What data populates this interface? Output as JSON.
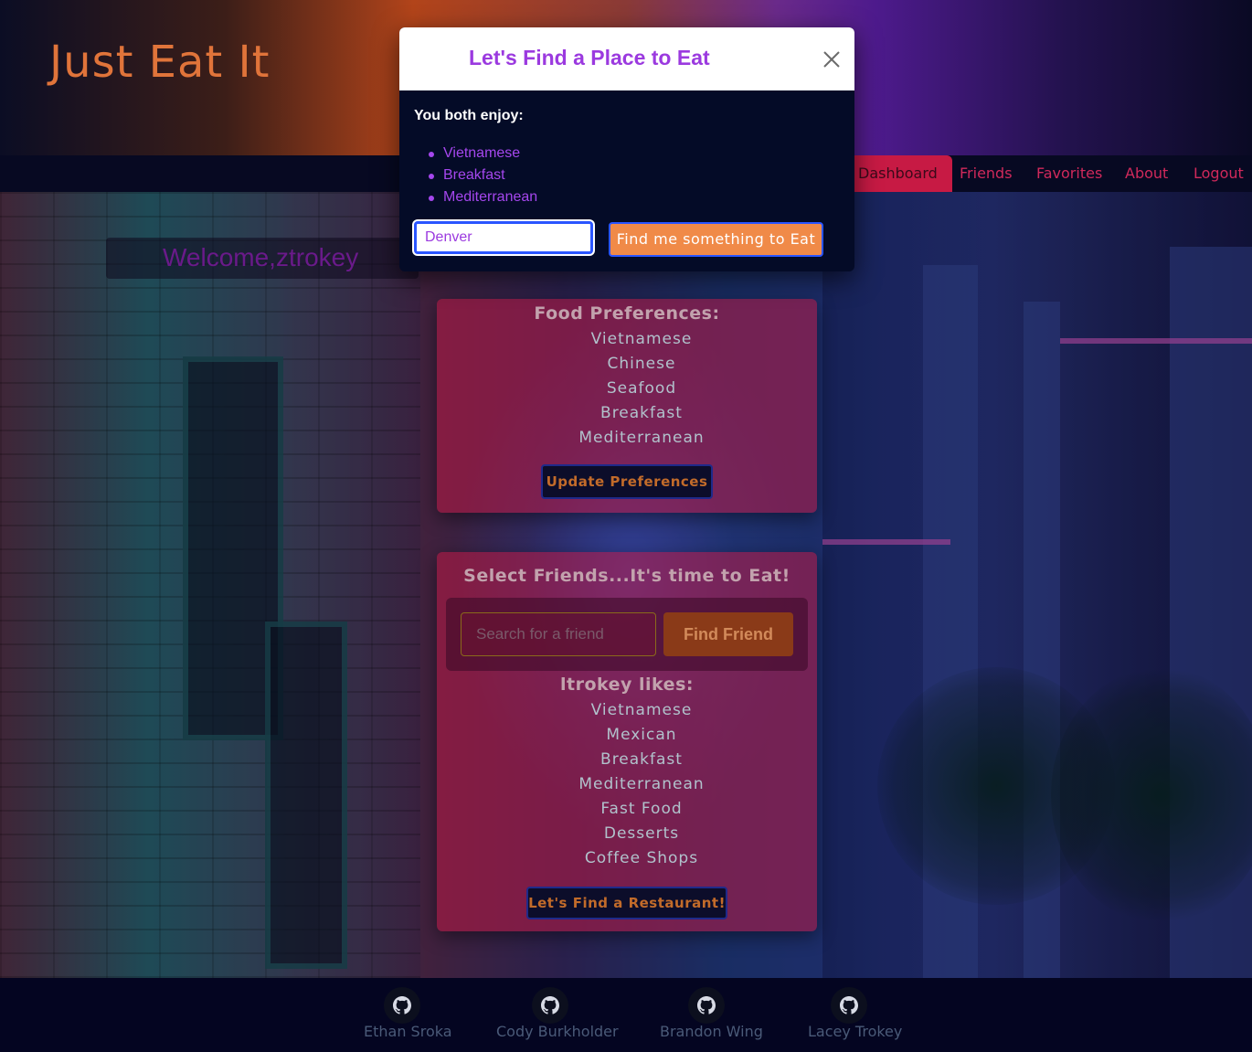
{
  "header": {
    "brand": "Just Eat It"
  },
  "nav": {
    "items": [
      {
        "label": "Dashboard",
        "active": true
      },
      {
        "label": "Friends",
        "active": false
      },
      {
        "label": "Favorites",
        "active": false
      },
      {
        "label": "About",
        "active": false
      },
      {
        "label": "Logout",
        "active": false
      }
    ]
  },
  "welcome": {
    "text": "Welcome,ztrokey"
  },
  "preferences": {
    "title": "Food Preferences:",
    "items": [
      "Vietnamese",
      "Chinese",
      "Seafood",
      "Breakfast",
      "Mediterranean"
    ],
    "button": "Update Preferences"
  },
  "friends": {
    "title": "Select Friends...It's time to Eat!",
    "search_placeholder": "Search for a friend",
    "find_button": "Find Friend",
    "friend_title": "ltrokey likes:",
    "friend_items": [
      "Vietnamese",
      "Mexican",
      "Breakfast",
      "Mediterranean",
      "Fast Food",
      "Desserts",
      "Coffee Shops"
    ],
    "restaurant_button": "Let's Find a Restaurant!"
  },
  "modal": {
    "title": "Let's Find a Place to Eat",
    "close_icon": "close-icon",
    "subtitle": "You both enjoy:",
    "shared": [
      "Vietnamese",
      "Breakfast",
      "Mediterranean"
    ],
    "city_value": "Denver",
    "submit": "Find me something to Eat"
  },
  "footer": {
    "members": [
      "Ethan Sroka",
      "Cody Burkholder",
      "Brandon Wing",
      "Lacey Trokey"
    ],
    "icon": "github-icon"
  },
  "colors": {
    "accent_purple": "#9b3adf",
    "accent_orange": "#f08a48",
    "card_red": "#be1a46",
    "nav_pink": "#d0295b"
  }
}
